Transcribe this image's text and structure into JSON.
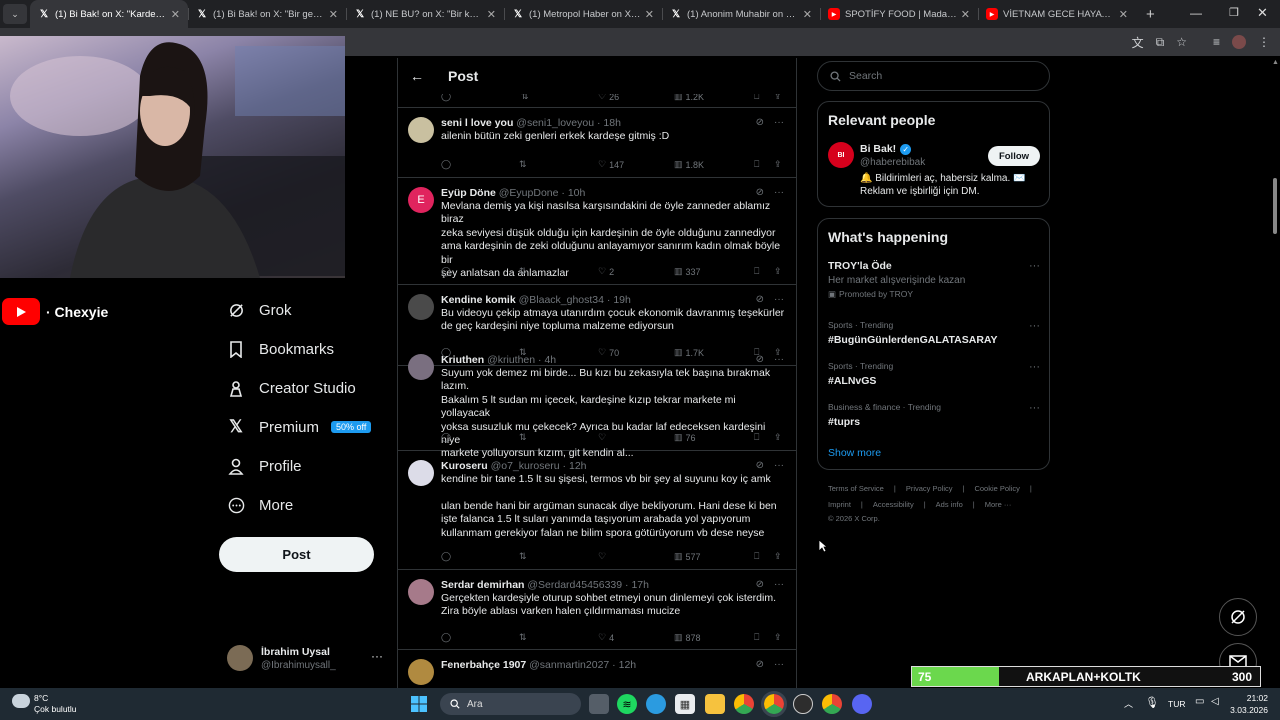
{
  "browser": {
    "tabs": [
      {
        "title": "(1) Bi Bak! on X: \"Kardeşini mark",
        "icon": "x-logo",
        "active": true
      },
      {
        "title": "(1) Bi Bak! on X: \"Bir genç, haftal",
        "icon": "x-logo"
      },
      {
        "title": "(1) NE BU? on X: \"Bir kadın, iki fı",
        "icon": "x-logo"
      },
      {
        "title": "(1) Metropol Haber on X: \"Bir ağ",
        "icon": "x-logo"
      },
      {
        "title": "(1) Anonim Muhabir on X: \"İki k",
        "icon": "x-logo"
      },
      {
        "title": "SPOTİFY FOOD | Madara Olduk",
        "icon": "youtube-logo"
      },
      {
        "title": "VİETNAM GECE HAYATI BENİ Ç",
        "icon": "youtube-logo"
      }
    ]
  },
  "stream": {
    "channel": "· Chexyie"
  },
  "nav": {
    "items": [
      {
        "label": "Grok",
        "icon": "grok-icon"
      },
      {
        "label": "Bookmarks",
        "icon": "bookmark-icon"
      },
      {
        "label": "Creator Studio",
        "icon": "creator-studio-icon"
      },
      {
        "label": "Premium",
        "icon": "x-premium-icon",
        "badge": "50% off"
      },
      {
        "label": "Profile",
        "icon": "profile-icon"
      },
      {
        "label": "More",
        "icon": "more-circle-icon"
      }
    ],
    "post_label": "Post",
    "account": {
      "name": "İbrahim Uysal",
      "handle": "@Ibrahimuysall_"
    }
  },
  "feed": {
    "title": "Post",
    "top_partial": {
      "likes": "26",
      "views": "1.2K"
    },
    "tweets": [
      {
        "name": "seni l love you",
        "handle": "@seni1_loveyou",
        "time": "18h",
        "lines": [
          "ailenin bütün zeki genleri erkek kardeşe gitmiş :D"
        ],
        "replies": "",
        "likes": "147",
        "views": "1.8K"
      },
      {
        "name": "Eyüp Döne",
        "handle": "@EyupDone",
        "time": "10h",
        "lines": [
          "Mevlana demiş ya kişi nasılsa karşısındakini de öyle zanneder ablamız biraz",
          "zeka seviyesi düşük olduğu için kardeşinin de öyle olduğunu zannediyor",
          "ama kardeşinin de zeki olduğunu anlayamıyor sanırım kadın olmak böyle bir",
          "şey anlatsan da anlamazlar"
        ],
        "likes": "2",
        "views": "337"
      },
      {
        "name": "Kendine komik",
        "handle": "@Blaack_ghost34",
        "time": "19h",
        "lines": [
          "Bu videoyu çekip atmaya utanırdım çocuk ekonomik davranmış teşekürler",
          "de geç kardeşini niye topluma malzeme ediyorsun"
        ],
        "likes": "70",
        "views": "1.7K"
      },
      {
        "name": "Kriuthen",
        "handle": "@kriuthen",
        "time": "4h",
        "lines": [
          "Suyum yok demez mi birde... Bu kızı bu zekasıyla tek başına bırakmak lazım.",
          "Bakalım 5 lt sudan mı içecek, kardeşine kızıp tekrar markete mi yollayacak",
          "yoksa susuzluk mu çekecek? Ayrıca bu kadar laf edeceksen kardeşini niye",
          "markete yolluyorsun kızım, git kendin al..."
        ],
        "likes": "",
        "views": "76"
      },
      {
        "name": "Kuroseru",
        "handle": "@o7_kuroseru",
        "time": "12h",
        "lines": [
          "kendine bir tane 1.5 lt su şişesi, termos vb bir şey al suyunu koy iç amk",
          "",
          "ulan bende hani bir argüman sunacak diye bekliyorum. Hani dese ki ben",
          "işte falanca 1.5 lt suları yanımda taşıyorum arabada yol yapıyorum",
          "kullanmam gerekiyor falan ne bilim spora götürüyorum vb dese neyse"
        ],
        "likes": "",
        "views": "577"
      },
      {
        "name": "Serdar demirhan",
        "handle": "@Serdard45456339",
        "time": "17h",
        "lines": [
          "Gerçekten kardeşiyle oturup sohbet etmeyi onun dinlemeyi çok isterdim.",
          "Zira böyle ablası varken halen çıldırmaması mucize"
        ],
        "likes": "4",
        "views": "878"
      },
      {
        "name": "Fenerbahçe 1907",
        "handle": "@sanmartin2027",
        "time": "12h",
        "lines": [],
        "likes": "",
        "views": ""
      }
    ]
  },
  "right": {
    "search_placeholder": "Search",
    "relevant": {
      "title": "Relevant people",
      "name": "Bi Bak!",
      "handle": "@haberebibak",
      "follow_label": "Follow",
      "bio_1": "🔔 Bildirimleri aç, habersiz kalma. ✉️",
      "bio_2": "Reklam ve işbirliği için DM."
    },
    "happening": {
      "title": "What's happening",
      "trends": [
        {
          "meta": "",
          "name": "TROY'la Öde",
          "sub": "Her market alışverişinde kazan",
          "promo": "Promoted by TROY"
        },
        {
          "meta": "Sports · Trending",
          "name": "#BugünGünlerdenGALATASARAY"
        },
        {
          "meta": "Sports · Trending",
          "name": "#ALNvGS"
        },
        {
          "meta": "Business & finance · Trending",
          "name": "#tuprs"
        }
      ],
      "show_more": "Show more"
    },
    "footer_row1": [
      "Terms of Service",
      "|",
      "Privacy Policy",
      "|",
      "Cookie Policy",
      "|"
    ],
    "footer_row2": [
      "Imprint",
      "|",
      "Accessibility",
      "|",
      "Ads info",
      "|",
      "More ···"
    ],
    "copyright": "© 2026 X Corp."
  },
  "overlay": {
    "left_value": "75",
    "label": "ARKAPLAN+KOLTK",
    "right_value": "300",
    "progress": 0.25
  },
  "taskbar": {
    "weather_temp": "8°C",
    "weather_desc": "Çok bulutlu",
    "search": "Ara",
    "lang": "TUR",
    "time": "21:02",
    "date": "3.03.2026"
  },
  "colors": {
    "accent": "#1d9bf0",
    "background": "#000000",
    "border": "#2f3336",
    "muted": "#71767b",
    "overlay_green": "#6bd84d"
  }
}
